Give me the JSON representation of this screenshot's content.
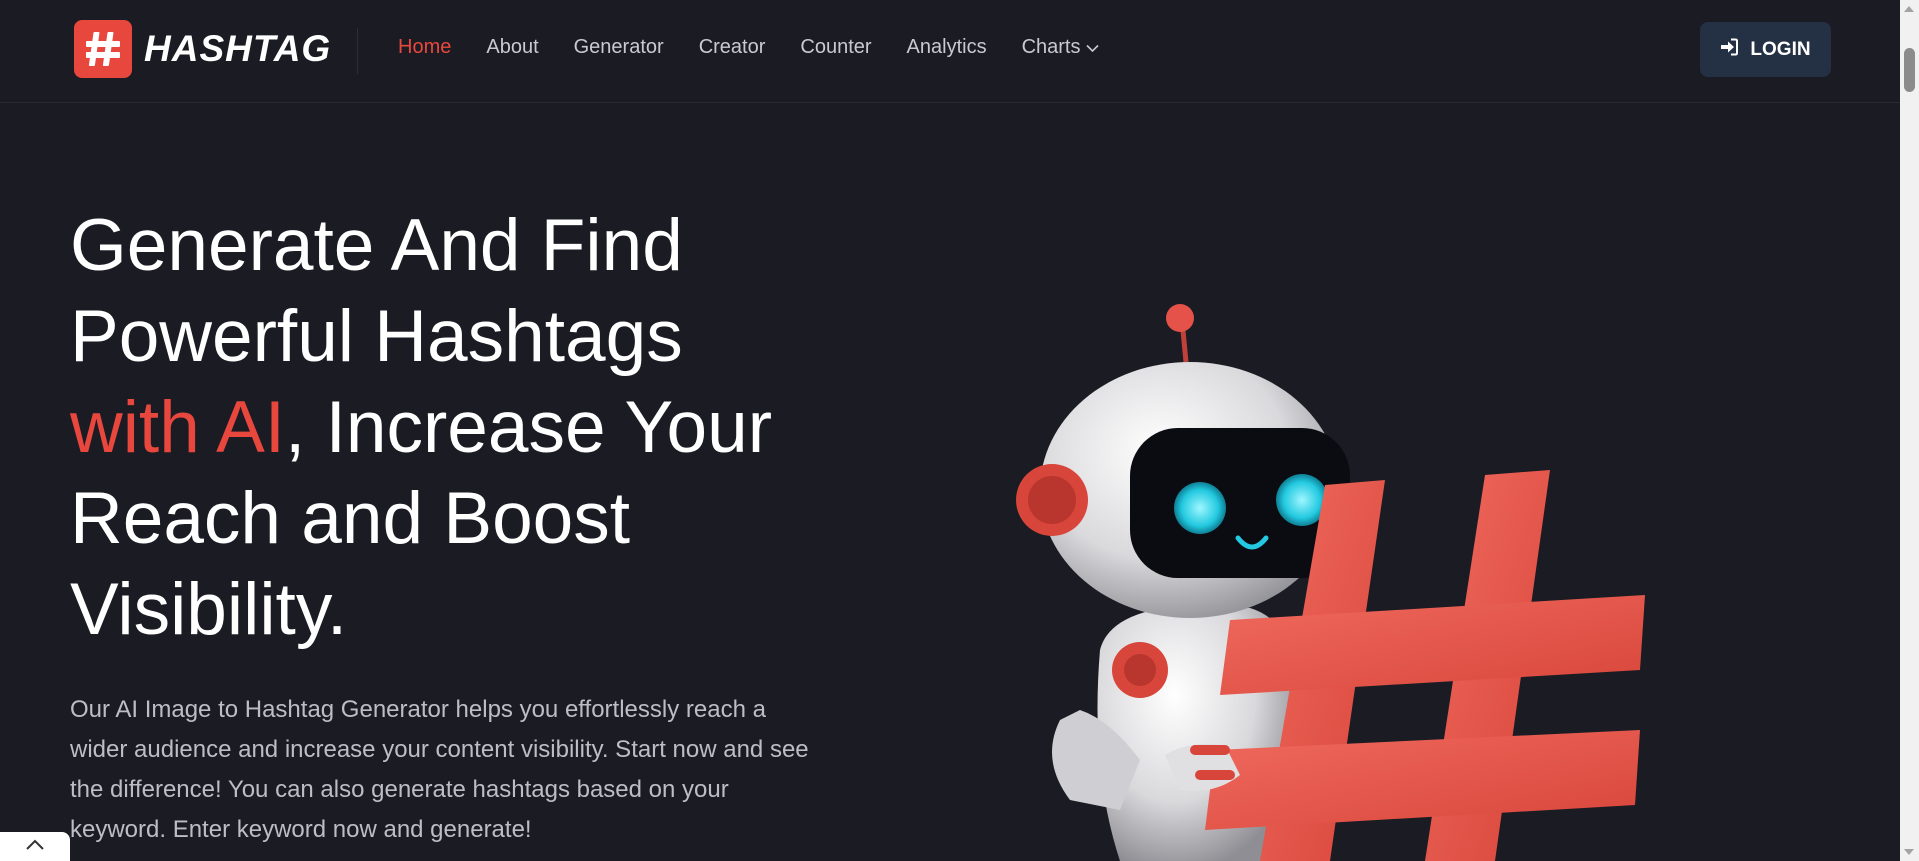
{
  "brand": {
    "name": "HASHTAG",
    "accent_color": "#e8473e",
    "background_color": "#1b1b23"
  },
  "nav": {
    "items": [
      {
        "label": "Home",
        "active": true
      },
      {
        "label": "About",
        "active": false
      },
      {
        "label": "Generator",
        "active": false
      },
      {
        "label": "Creator",
        "active": false
      },
      {
        "label": "Counter",
        "active": false
      },
      {
        "label": "Analytics",
        "active": false
      },
      {
        "label": "Charts",
        "active": false,
        "has_dropdown": true
      }
    ],
    "dropdown_icon": "chevron-down-icon"
  },
  "login": {
    "label": "LOGIN",
    "icon": "sign-in-icon",
    "button_color": "#243044"
  },
  "hero": {
    "title_part1": "Generate And Find Powerful Hashtags ",
    "title_accent": "with AI",
    "title_part2": ", Increase Your Reach and Boost Visibility.",
    "description": "Our AI Image to Hashtag Generator helps you effortlessly reach a wider audience and increase your content visibility. Start now and see the difference! You can also generate hashtags based on your keyword. Enter keyword now and generate!"
  },
  "back_to_top": {
    "icon": "chevron-up-icon"
  }
}
